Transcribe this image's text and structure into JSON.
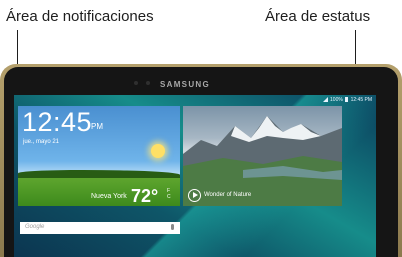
{
  "callouts": {
    "notification_area": "Área de notificaciones",
    "status_area": "Área de estatus"
  },
  "device": {
    "brand": "SAMSUNG"
  },
  "status_bar": {
    "battery": "100%",
    "time": "12:45 PM"
  },
  "weather_widget": {
    "time": "12:45",
    "ampm": "PM",
    "date": "jue., mayo 21",
    "city": "Nueva York",
    "temperature": "72°",
    "unit_f": "F",
    "unit_c": "C"
  },
  "photo_widget": {
    "caption": "Wonder of Nature"
  },
  "search_bar": {
    "label": "Google"
  },
  "colors": {
    "screen_accent": "#168c8a",
    "device_frame": "#b4a06c"
  }
}
